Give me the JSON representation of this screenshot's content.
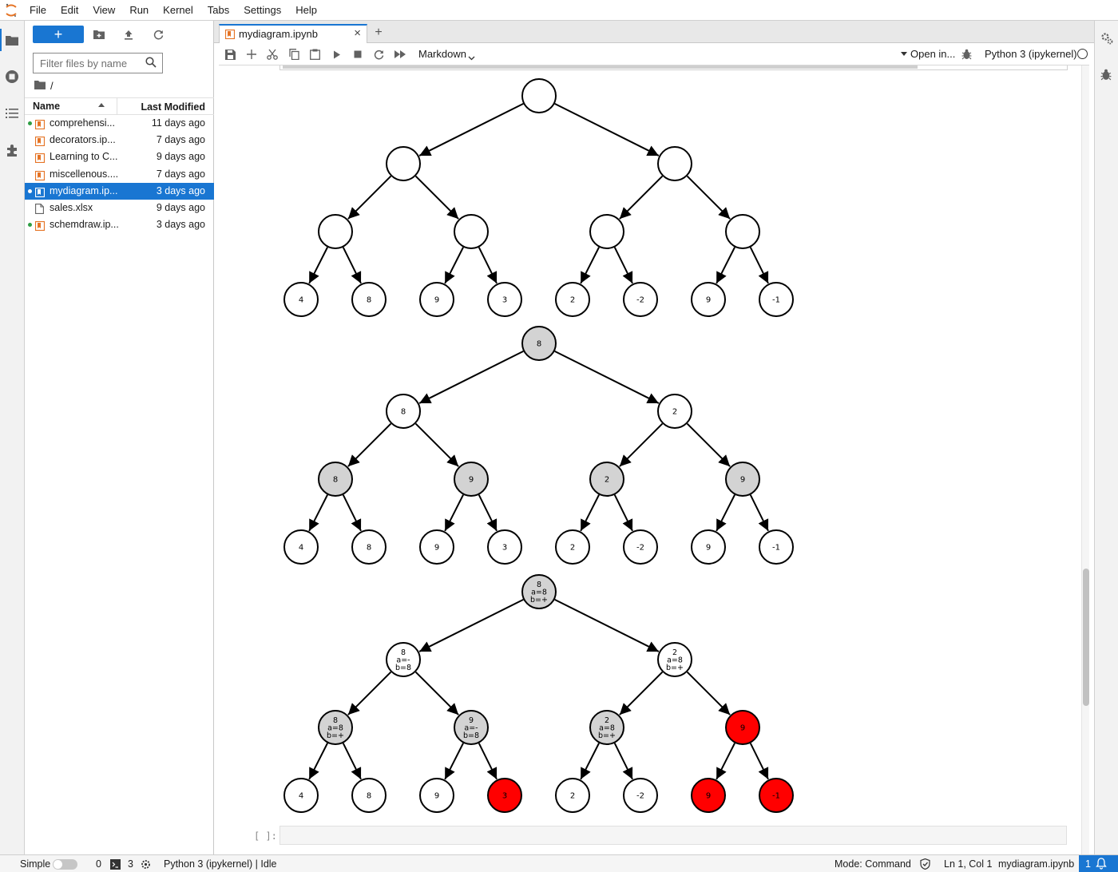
{
  "menubar": {
    "items": [
      "File",
      "Edit",
      "View",
      "Run",
      "Kernel",
      "Tabs",
      "Settings",
      "Help"
    ]
  },
  "filebrowser": {
    "new_label": "+",
    "filter_placeholder": "Filter files by name",
    "breadcrumb": "/",
    "col_name": "Name",
    "col_modified": "Last Modified",
    "files": [
      {
        "name": "comprehensi...",
        "modified": "11 days ago",
        "type": "notebook",
        "running": true,
        "selected": false
      },
      {
        "name": "decorators.ip...",
        "modified": "7 days ago",
        "type": "notebook",
        "running": false,
        "selected": false
      },
      {
        "name": "Learning to C...",
        "modified": "9 days ago",
        "type": "notebook",
        "running": false,
        "selected": false
      },
      {
        "name": "miscellenous....",
        "modified": "7 days ago",
        "type": "notebook",
        "running": false,
        "selected": false
      },
      {
        "name": "mydiagram.ip...",
        "modified": "3 days ago",
        "type": "notebook",
        "running": true,
        "selected": true
      },
      {
        "name": "sales.xlsx",
        "modified": "9 days ago",
        "type": "file",
        "running": false,
        "selected": false
      },
      {
        "name": "schemdraw.ip...",
        "modified": "3 days ago",
        "type": "notebook",
        "running": true,
        "selected": false
      }
    ]
  },
  "tab": {
    "title": "mydiagram.ipynb",
    "close": "×",
    "add": "+"
  },
  "notebook_toolbar": {
    "cell_type": "Markdown",
    "open_in": "Open in...",
    "kernel": "Python 3 (ipykernel)"
  },
  "empty_cell_prompt": "[ ]:",
  "trees": [
    {
      "nodes": [
        {
          "id": "r",
          "lines": [],
          "fill": "white"
        },
        {
          "id": "l",
          "lines": [],
          "fill": "white"
        },
        {
          "id": "rr",
          "lines": [],
          "fill": "white"
        },
        {
          "id": "ll",
          "lines": [],
          "fill": "white"
        },
        {
          "id": "lr",
          "lines": [],
          "fill": "white"
        },
        {
          "id": "rl",
          "lines": [],
          "fill": "white"
        },
        {
          "id": "rrr",
          "lines": [],
          "fill": "white"
        },
        {
          "id": "lf1",
          "lines": [
            "4"
          ],
          "fill": "white"
        },
        {
          "id": "lf2",
          "lines": [
            "8"
          ],
          "fill": "white"
        },
        {
          "id": "lf3",
          "lines": [
            "9"
          ],
          "fill": "white"
        },
        {
          "id": "lf4",
          "lines": [
            "3"
          ],
          "fill": "white"
        },
        {
          "id": "lf5",
          "lines": [
            "2"
          ],
          "fill": "white"
        },
        {
          "id": "lf6",
          "lines": [
            "-2"
          ],
          "fill": "white"
        },
        {
          "id": "lf7",
          "lines": [
            "9"
          ],
          "fill": "white"
        },
        {
          "id": "lf8",
          "lines": [
            "-1"
          ],
          "fill": "white"
        }
      ]
    },
    {
      "nodes": [
        {
          "id": "r",
          "lines": [
            "8"
          ],
          "fill": "gray"
        },
        {
          "id": "l",
          "lines": [
            "8"
          ],
          "fill": "white"
        },
        {
          "id": "rr",
          "lines": [
            "2"
          ],
          "fill": "white"
        },
        {
          "id": "ll",
          "lines": [
            "8"
          ],
          "fill": "gray"
        },
        {
          "id": "lr",
          "lines": [
            "9"
          ],
          "fill": "gray"
        },
        {
          "id": "rl",
          "lines": [
            "2"
          ],
          "fill": "gray"
        },
        {
          "id": "rrr",
          "lines": [
            "9"
          ],
          "fill": "gray"
        },
        {
          "id": "lf1",
          "lines": [
            "4"
          ],
          "fill": "white"
        },
        {
          "id": "lf2",
          "lines": [
            "8"
          ],
          "fill": "white"
        },
        {
          "id": "lf3",
          "lines": [
            "9"
          ],
          "fill": "white"
        },
        {
          "id": "lf4",
          "lines": [
            "3"
          ],
          "fill": "white"
        },
        {
          "id": "lf5",
          "lines": [
            "2"
          ],
          "fill": "white"
        },
        {
          "id": "lf6",
          "lines": [
            "-2"
          ],
          "fill": "white"
        },
        {
          "id": "lf7",
          "lines": [
            "9"
          ],
          "fill": "white"
        },
        {
          "id": "lf8",
          "lines": [
            "-1"
          ],
          "fill": "white"
        }
      ]
    },
    {
      "nodes": [
        {
          "id": "r",
          "lines": [
            "8",
            "a=8",
            "b=+"
          ],
          "fill": "gray"
        },
        {
          "id": "l",
          "lines": [
            "8",
            "a=-",
            "b=8"
          ],
          "fill": "white"
        },
        {
          "id": "rr",
          "lines": [
            "2",
            "a=8",
            "b=+"
          ],
          "fill": "white"
        },
        {
          "id": "ll",
          "lines": [
            "8",
            "a=8",
            "b=+"
          ],
          "fill": "gray"
        },
        {
          "id": "lr",
          "lines": [
            "9",
            "a=-",
            "b=8"
          ],
          "fill": "gray"
        },
        {
          "id": "rl",
          "lines": [
            "2",
            "a=8",
            "b=+"
          ],
          "fill": "gray"
        },
        {
          "id": "rrr",
          "lines": [
            "9"
          ],
          "fill": "red"
        },
        {
          "id": "lf1",
          "lines": [
            "4"
          ],
          "fill": "white"
        },
        {
          "id": "lf2",
          "lines": [
            "8"
          ],
          "fill": "white"
        },
        {
          "id": "lf3",
          "lines": [
            "9"
          ],
          "fill": "white"
        },
        {
          "id": "lf4",
          "lines": [
            "3"
          ],
          "fill": "red"
        },
        {
          "id": "lf5",
          "lines": [
            "2"
          ],
          "fill": "white"
        },
        {
          "id": "lf6",
          "lines": [
            "-2"
          ],
          "fill": "white"
        },
        {
          "id": "lf7",
          "lines": [
            "9"
          ],
          "fill": "red"
        },
        {
          "id": "lf8",
          "lines": [
            "-1"
          ],
          "fill": "red"
        }
      ]
    }
  ],
  "colors": {
    "accent": "#1976d2",
    "node_white": "#ffffff",
    "node_gray": "#d3d3d3",
    "node_red": "#ff0000",
    "running_dot": "#2e9e44",
    "notebook_icon": "#e57324"
  },
  "statusbar": {
    "mode_simple": "Simple",
    "terminals": "0",
    "kernels": "3",
    "kernel_status": "Python 3 (ipykernel) | Idle",
    "mode": "Mode: Command",
    "cursor": "Ln 1, Col 1",
    "filename": "mydiagram.ipynb",
    "notifications": "1"
  }
}
